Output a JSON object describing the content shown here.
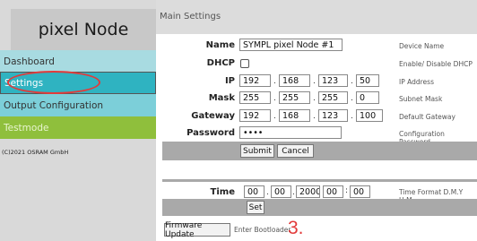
{
  "sidebar": {
    "brand": "pixel Node",
    "items": [
      {
        "label": "Dashboard"
      },
      {
        "label": "Settings"
      },
      {
        "label": "Output Configuration"
      },
      {
        "label": "Testmode"
      }
    ],
    "copyright": "(C)2021 OSRAM GmbH"
  },
  "header": {
    "title": "Main Settings"
  },
  "settings": {
    "name": {
      "label": "Name",
      "value": "SYMPL pixel Node #1",
      "hint": "Device Name"
    },
    "dhcp": {
      "label": "DHCP",
      "checked": false,
      "hint": "Enable/ Disable DHCP"
    },
    "ip": {
      "label": "IP",
      "octets": [
        "192",
        "168",
        "123",
        "50"
      ],
      "hint": "IP Address"
    },
    "mask": {
      "label": "Mask",
      "octets": [
        "255",
        "255",
        "255",
        "0"
      ],
      "hint": "Subnet Mask"
    },
    "gateway": {
      "label": "Gateway",
      "octets": [
        "192",
        "168",
        "123",
        "100"
      ],
      "hint": "Default Gateway"
    },
    "password": {
      "label": "Password",
      "value": "••••",
      "hint": "Configuration Password"
    },
    "submit_label": "Submit",
    "cancel_label": "Cancel"
  },
  "time": {
    "label": "Time",
    "hour": "00",
    "minute": "00",
    "year": "2000",
    "field4": "00",
    "field5": "00",
    "hint": "Time Format D.M.Y H:M",
    "set_label": "Set"
  },
  "firmware": {
    "button_label": "Firmware Update",
    "hint": "Enter Bootloader"
  },
  "annotation": {
    "number": "3.",
    "color": "#e23a3a"
  }
}
